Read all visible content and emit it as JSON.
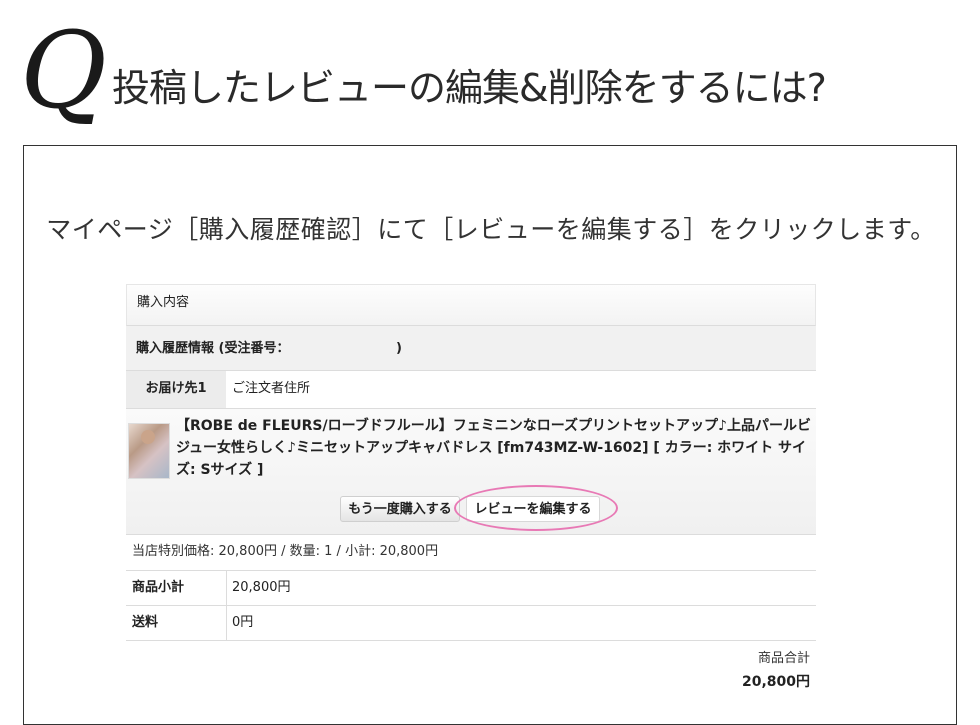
{
  "header": {
    "q_mark": "Q",
    "title": "投稿したレビューの編集&削除をするには?"
  },
  "instruction": "マイページ［購入履歴確認］にて［レビューを編集する］をクリックします。",
  "order": {
    "section_title": "購入内容",
    "history_label": "購入履歴情報 (受注番号：",
    "history_close": ")",
    "destination": {
      "label": "お届け先1",
      "value": "ご注文者住所"
    },
    "product": {
      "name": "【ROBE de FLEURS/ローブドフルール】フェミニンなローズプリントセットアップ♪上品パールビジュー女性らしく♪ミニセットアップキャバドレス [fm743MZ-W-1602] [ カラー: ホワイト サイズ: Sサイズ ]",
      "thumbnail_icon": "dress-photo-thumbnail",
      "rebuy_button": "もう一度購入する",
      "review_button": "レビューを編集する"
    },
    "price_line": "当店特別価格: 20,800円 / 数量: 1 / 小計: 20,800円",
    "subtotal": {
      "label": "商品小計",
      "value": "20,800円"
    },
    "shipping": {
      "label": "送料",
      "value": "0円"
    },
    "total": {
      "label": "商品合計",
      "value": "20,800円"
    }
  },
  "colors": {
    "highlight": "#e879b5"
  }
}
